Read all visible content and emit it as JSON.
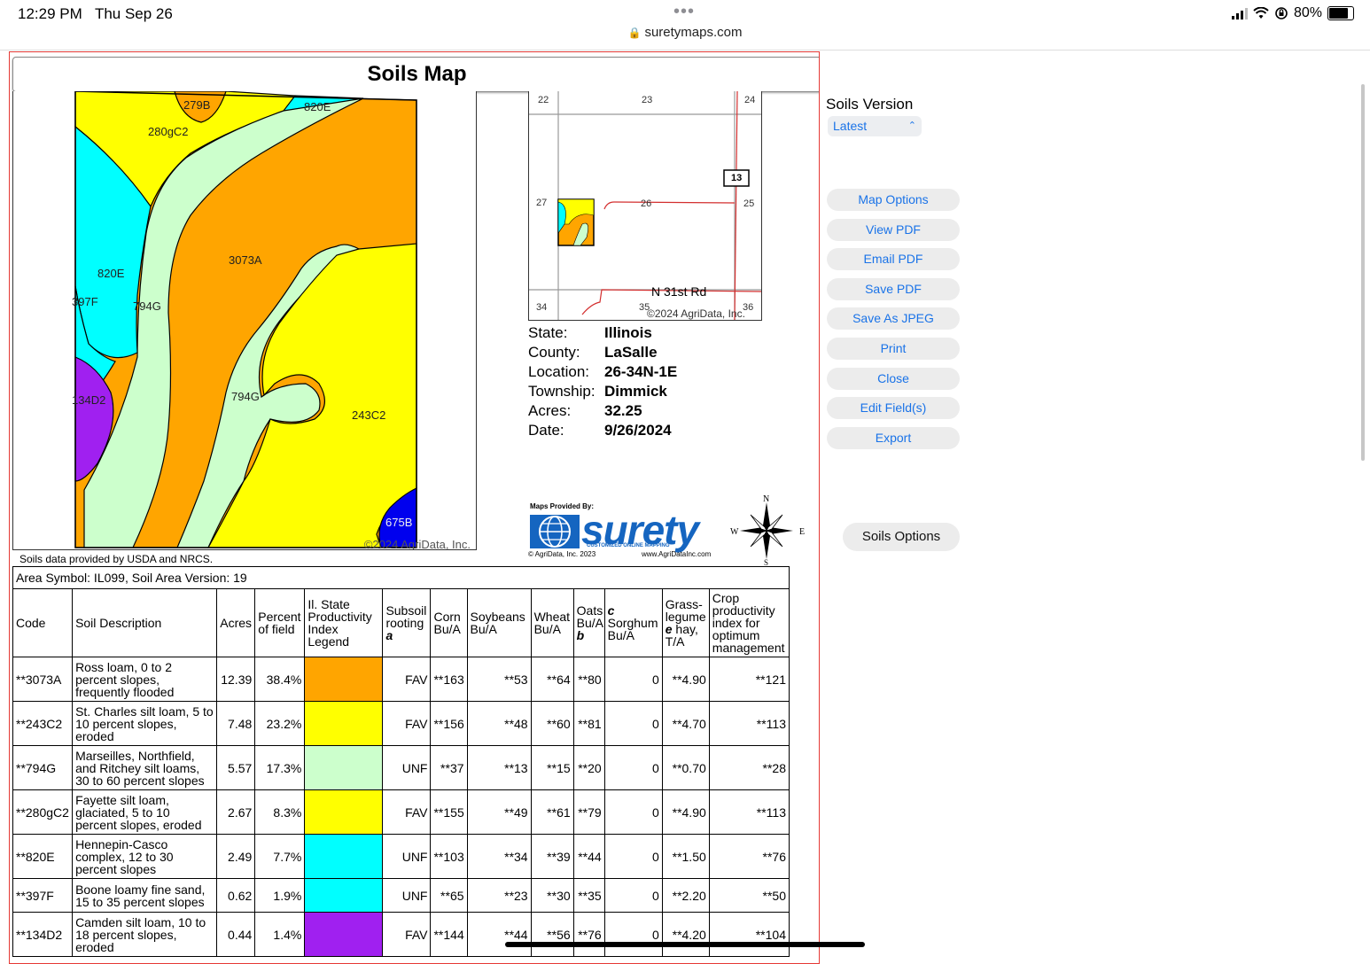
{
  "status_bar": {
    "time": "12:29 PM",
    "date": "Thu Sep 26",
    "url": "suretymaps.com",
    "battery": "80%",
    "battery_level": 0.8
  },
  "report": {
    "title": "Soils Map",
    "map_labels": [
      "279B",
      "820E",
      "280gC2",
      "3073A",
      "820E",
      "397F",
      "794G",
      "134D2",
      "794G",
      "243C2",
      "675B"
    ],
    "map_copyright": "©2024 AgriData, Inc.",
    "locator": {
      "sections": [
        "22",
        "23",
        "24",
        "27",
        "26",
        "25",
        "34",
        "35",
        "36"
      ],
      "highway": "13",
      "road": "N 31st Rd",
      "copyright": "©2024 AgriData, Inc."
    },
    "info": [
      {
        "key": "State:",
        "value": "Illinois"
      },
      {
        "key": "County:",
        "value": "LaSalle"
      },
      {
        "key": "Location:",
        "value": "26-34N-1E"
      },
      {
        "key": "Township:",
        "value": "Dimmick"
      },
      {
        "key": "Acres:",
        "value": "32.25"
      },
      {
        "key": "Date:",
        "value": "9/26/2024"
      }
    ],
    "logo": {
      "provided_by": "Maps Provided By:",
      "brand": "surety",
      "tagline": "CUSTOMIZED ONLINE MAPPING",
      "copyright": "© AgriData, Inc. 2023",
      "website": "www.AgriDataInc.com"
    },
    "compass": {
      "n": "N",
      "s": "S",
      "e": "E",
      "w": "W"
    },
    "source_note": "Soils data provided by USDA and NRCS.",
    "area_symbol": "Area Symbol: IL099, Soil Area Version: 19",
    "table_headers": {
      "code": "Code",
      "desc": "Soil Description",
      "acres": "Acres",
      "percent": "Percent of field",
      "legend": "Il. State Productivity Index Legend",
      "subsoil": "Subsoil rooting",
      "subsoil_note": "a",
      "corn": "Corn Bu/A",
      "soybeans": "Soybeans Bu/A",
      "wheat": "Wheat Bu/A",
      "oats": "Oats Bu/A",
      "oats_note": "b",
      "sorghum_note": "c",
      "sorghum": "Sorghum Bu/A",
      "grass": "Grass-legume",
      "grass_note": "e",
      "grass_rest": "hay, T/A",
      "crop": "Crop productivity index for optimum management"
    },
    "rows": [
      {
        "code": "**3073A",
        "desc": "Ross loam, 0 to 2 percent slopes, frequently flooded",
        "acres": "12.39",
        "percent": "38.4%",
        "color": "#FFA500",
        "subsoil": "FAV",
        "corn": "**163",
        "soy": "**53",
        "wheat": "**64",
        "oats": "**80",
        "sorghum": "0",
        "grass": "**4.90",
        "crop": "**121"
      },
      {
        "code": "**243C2",
        "desc": "St. Charles silt loam, 5 to 10 percent slopes, eroded",
        "acres": "7.48",
        "percent": "23.2%",
        "color": "#FFFF00",
        "subsoil": "FAV",
        "corn": "**156",
        "soy": "**48",
        "wheat": "**60",
        "oats": "**81",
        "sorghum": "0",
        "grass": "**4.70",
        "crop": "**113"
      },
      {
        "code": "**794G",
        "desc": "Marseilles, Northfield, and Ritchey silt loams, 30 to 60 percent slopes",
        "acres": "5.57",
        "percent": "17.3%",
        "color": "#CCFFCC",
        "subsoil": "UNF",
        "corn": "**37",
        "soy": "**13",
        "wheat": "**15",
        "oats": "**20",
        "sorghum": "0",
        "grass": "**0.70",
        "crop": "**28"
      },
      {
        "code": "**280gC2",
        "desc": "Fayette silt loam, glaciated, 5 to 10 percent slopes, eroded",
        "acres": "2.67",
        "percent": "8.3%",
        "color": "#FFFF00",
        "subsoil": "FAV",
        "corn": "**155",
        "soy": "**49",
        "wheat": "**61",
        "oats": "**79",
        "sorghum": "0",
        "grass": "**4.90",
        "crop": "**113"
      },
      {
        "code": "**820E",
        "desc": "Hennepin-Casco complex, 12 to 30 percent slopes",
        "acres": "2.49",
        "percent": "7.7%",
        "color": "#00FFFF",
        "subsoil": "UNF",
        "corn": "**103",
        "soy": "**34",
        "wheat": "**39",
        "oats": "**44",
        "sorghum": "0",
        "grass": "**1.50",
        "crop": "**76"
      },
      {
        "code": "**397F",
        "desc": "Boone loamy fine sand, 15 to 35 percent slopes",
        "acres": "0.62",
        "percent": "1.9%",
        "color": "#00FFFF",
        "subsoil": "UNF",
        "corn": "**65",
        "soy": "**23",
        "wheat": "**30",
        "oats": "**35",
        "sorghum": "0",
        "grass": "**2.20",
        "crop": "**50"
      },
      {
        "code": "**134D2",
        "desc": "Camden silt loam, 10 to 18 percent slopes, eroded",
        "acres": "0.44",
        "percent": "1.4%",
        "color": "#A020F0",
        "subsoil": "FAV",
        "corn": "**144",
        "soy": "**44",
        "wheat": "**56",
        "oats": "**76",
        "sorghum": "0",
        "grass": "**4.20",
        "crop": "**104"
      }
    ]
  },
  "sidebar": {
    "soils_version_label": "Soils Version",
    "soils_version_value": "Latest",
    "buttons": [
      "Map Options",
      "View PDF",
      "Email PDF",
      "Save PDF",
      "Save As JPEG",
      "Print",
      "Close",
      "Edit Field(s)",
      "Export"
    ],
    "soils_options": "Soils Options"
  },
  "colors": {
    "accent": "#1a73e8",
    "frame": "#e53935"
  }
}
